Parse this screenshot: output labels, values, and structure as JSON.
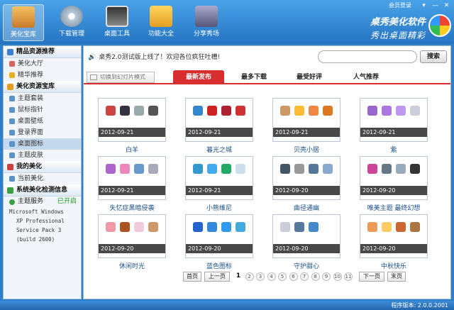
{
  "top": {
    "login": "会员登录",
    "tools": [
      {
        "label": "美化宝库",
        "icon": "treasure-box-icon"
      },
      {
        "label": "下载管理",
        "icon": "download-disc-icon"
      },
      {
        "label": "桌面工具",
        "icon": "desktop-tool-icon"
      },
      {
        "label": "功能大全",
        "icon": "function-box-icon"
      },
      {
        "label": "分享秀场",
        "icon": "share-icon"
      }
    ],
    "brand_title": "桌秀美化软件",
    "brand_slogan": "秀出桌面精彩"
  },
  "sidebar": {
    "sec1": "精品资源推荐",
    "sec1_items": [
      "美化大厅",
      "精华推荐"
    ],
    "sec2": "美化资源宝库",
    "sec2_items": [
      "主题套装",
      "鼠标指针",
      "桌面壁纸",
      "登录界面",
      "桌面图标",
      "主题皮肤"
    ],
    "sec3": "我的美化",
    "sec3_items": [
      "当前美化"
    ],
    "sec4": "系统美化检测信息",
    "service_label": "主题服务",
    "service_status": "已开启",
    "sysinfo": [
      "Microsoft Windows",
      "XP Professional",
      "Service Pack 3",
      "(build 2600)"
    ]
  },
  "main": {
    "notice": "桌秀2.0测试版上线了！欢迎各位疯狂吐槽!",
    "search_placeholder": "",
    "search_btn": "搜索",
    "slideshow": "切换到幻灯片模式",
    "tabs": [
      "最新发布",
      "最多下载",
      "最受好评",
      "人气推荐"
    ],
    "cards": [
      {
        "date": "2012-09-21",
        "title": "白羊"
      },
      {
        "date": "2012-09-21",
        "title": "暮光之城"
      },
      {
        "date": "2012-09-21",
        "title": "贝壳小居"
      },
      {
        "date": "2012-09-21",
        "title": "紫"
      },
      {
        "date": "2012-09-21",
        "title": "失忆症黑暗侵袭"
      },
      {
        "date": "2012-09-21",
        "title": "小熊维尼"
      },
      {
        "date": "2012-09-20",
        "title": "曲径通幽"
      },
      {
        "date": "2012-09-20",
        "title": "唯美主题 最终幻想"
      },
      {
        "date": "2012-09-20",
        "title": "休闲时光"
      },
      {
        "date": "2012-09-20",
        "title": "蓝色图标"
      },
      {
        "date": "2012-09-20",
        "title": "守护甜心"
      },
      {
        "date": "2012-09-20",
        "title": "中秋快乐"
      }
    ],
    "pager": {
      "first": "首页",
      "prev": "上一页",
      "pages": [
        "1",
        "2",
        "3",
        "4",
        "5",
        "6",
        "7",
        "8",
        "9",
        "10",
        "11"
      ],
      "next": "下一页",
      "last": "末页"
    }
  },
  "status": "程序版本: 2.0.0.2001"
}
